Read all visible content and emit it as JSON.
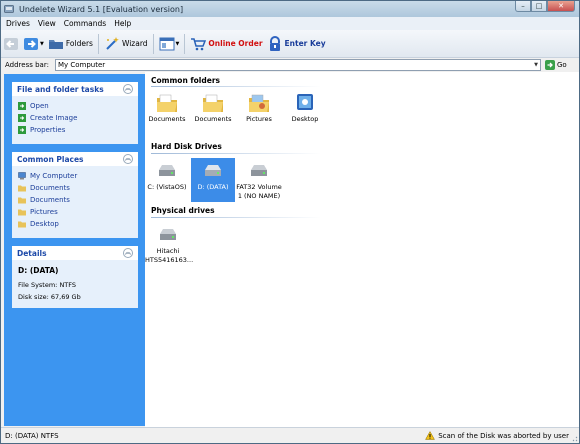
{
  "window": {
    "title": "Undelete Wizard 5.1 [Evaluation version]",
    "minimize": "–",
    "maximize": "□",
    "close": "✕"
  },
  "menu": [
    "Drives",
    "View",
    "Commands",
    "Help"
  ],
  "toolbar": {
    "folders_label": "Folders",
    "wizard_label": "Wizard",
    "online_order_label": "Online Order",
    "enter_key_label": "Enter Key"
  },
  "address": {
    "label": "Address bar:",
    "value": "My Computer",
    "go_label": "Go"
  },
  "panels": {
    "tasks": {
      "title": "File and folder tasks",
      "items": [
        "Open",
        "Create Image",
        "Properties"
      ]
    },
    "places": {
      "title": "Common Places",
      "items": [
        "My Computer",
        "Documents",
        "Documents",
        "Pictures",
        "Desktop"
      ]
    },
    "details": {
      "title": "Details",
      "name": "D: (DATA)",
      "file_system": "File System: NTFS",
      "disk_size": "Disk size: 67,69 Gb"
    }
  },
  "sections": {
    "common_folders": {
      "title": "Common folders",
      "items": [
        "Documents",
        "Documents",
        "Pictures",
        "Desktop"
      ]
    },
    "hard_disk_drives": {
      "title": "Hard Disk Drives",
      "items": [
        "C: (VistaOS)",
        "D: (DATA)",
        "FAT32 Volume 1 (NO NAME)"
      ],
      "selected": "D: (DATA)"
    },
    "physical_drives": {
      "title": "Physical drives",
      "items": [
        "Hitachi HTS5416163..."
      ]
    }
  },
  "status": {
    "left": "D: (DATA) NTFS",
    "right": "Scan of the Disk was aborted by user"
  },
  "colors": {
    "left_pane": "#3c95f0",
    "selection": "#3c8ce8",
    "panel_title": "#1d49a8",
    "online_order": "#d11010"
  }
}
